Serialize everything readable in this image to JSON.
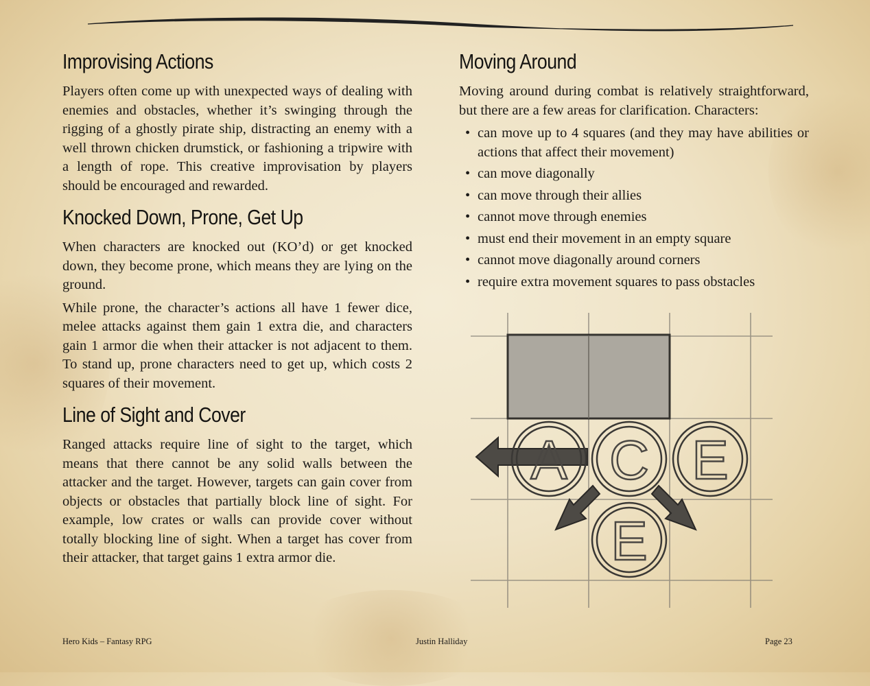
{
  "left_column": {
    "sections": [
      {
        "heading": "Improvising Actions",
        "paragraphs": [
          "Players often come up with unexpected ways of dealing with enemies and obstacles, whether it’s swinging through the rigging of a ghostly pirate ship, distracting an enemy with a well thrown chicken drumstick, or fashioning a tripwire with a length of rope.  This creative improvisation by players should be encouraged and rewarded."
        ]
      },
      {
        "heading": "Knocked Down, Prone, Get Up",
        "paragraphs": [
          "When characters are knocked out (KO’d) or get knocked down, they become prone, which means they are lying on the ground.",
          "While prone, the character’s actions all have 1 fewer dice, melee attacks against them gain 1 extra die, and characters gain 1 armor die when their attacker is not adjacent to them.  To stand up, prone characters need to get up, which costs 2 squares of their movement."
        ]
      },
      {
        "heading": "Line of Sight and Cover",
        "paragraphs": [
          "Ranged attacks require line of sight to the target, which means that there cannot be any solid walls between the attacker and the target.  However, targets can gain cover from objects or obstacles that partially block line of sight.  For example, low crates or walls can provide cover without totally blocking line of sight.  When a target has cover from their attacker, that target gains 1 extra armor die."
        ]
      }
    ]
  },
  "right_column": {
    "heading": "Moving Around",
    "intro": "Moving around during combat is relatively straightforward, but there are a few areas for clarification.  Characters:",
    "bullet_glyph": "•",
    "bullets": [
      "can move up to 4 squares (and they may have abilities or actions that affect their movement)",
      "can move diagonally",
      "can move through their allies",
      "cannot move through enemies",
      "must end their movement in an empty square",
      "cannot move diagonally around corners",
      "require extra movement squares to pass obstacles"
    ]
  },
  "diagram": {
    "tokens": [
      "A",
      "C",
      "E",
      "E"
    ]
  },
  "footer": {
    "left": "Hero Kids – Fantasy RPG",
    "center": "Justin Halliday",
    "right": "Page 23"
  },
  "colors": {
    "parchment": "#efe3c6",
    "ink": "#1c1a18",
    "pencil": "#5a5550",
    "obstacle_fill": "#a9a59d"
  }
}
